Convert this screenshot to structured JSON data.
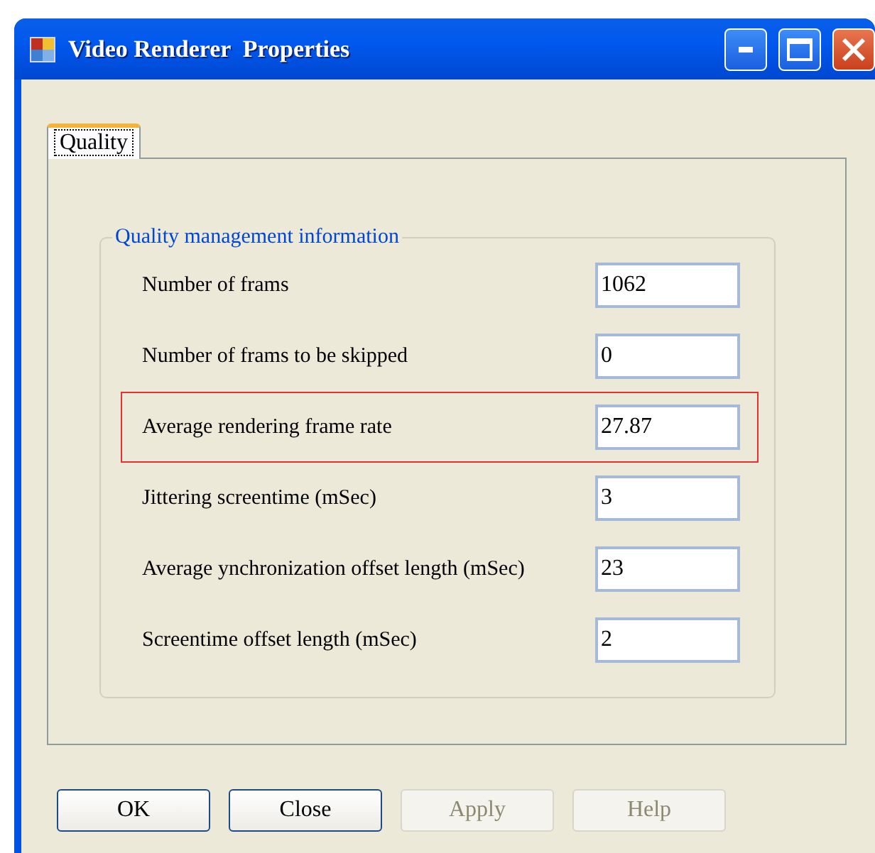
{
  "window": {
    "title": "Video Renderer  Properties"
  },
  "tabs": [
    {
      "label": "Quality",
      "selected": true
    }
  ],
  "group": {
    "title": "Quality management information",
    "rows": [
      {
        "label": "Number of frams",
        "value": "1062",
        "highlighted": false
      },
      {
        "label": "Number of frams to be skipped",
        "value": "0",
        "highlighted": false
      },
      {
        "label": "Average rendering frame rate",
        "value": "27.87",
        "highlighted": true
      },
      {
        "label": "Jittering screentime (mSec)",
        "value": "3",
        "highlighted": false
      },
      {
        "label": "Average ynchronization offset length (mSec)",
        "value": "23",
        "highlighted": false
      },
      {
        "label": "Screentime offset length (mSec)",
        "value": "2",
        "highlighted": false
      }
    ]
  },
  "buttons": [
    {
      "label": "OK",
      "disabled": false
    },
    {
      "label": "Close",
      "disabled": false
    },
    {
      "label": "Apply",
      "disabled": true
    },
    {
      "label": "Help",
      "disabled": true
    }
  ]
}
